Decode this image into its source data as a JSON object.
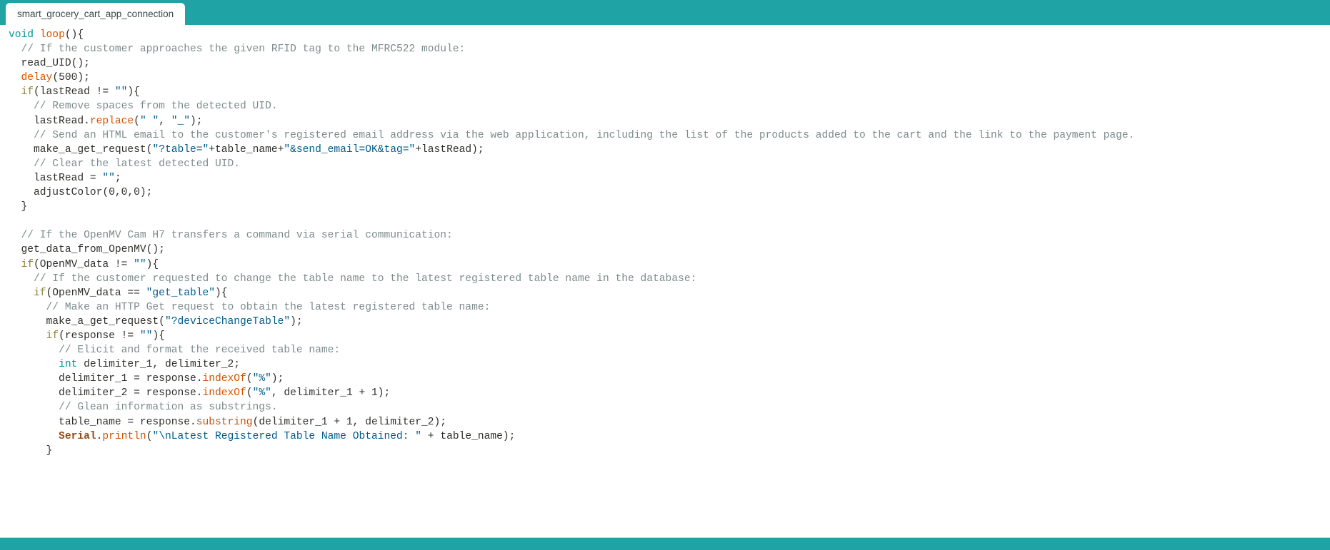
{
  "window": {
    "title": "smart_grocery_cart_app_connection",
    "accent_color": "#1fa3a5",
    "background_color": "#ffffff"
  },
  "tabbar": {
    "tabs": [
      {
        "label": "smart_grocery_cart_app_connection",
        "active": true
      }
    ]
  },
  "editor": {
    "language": "arduino-cpp",
    "font_size": "14.6px",
    "colors": {
      "type_keyword": "#00979c",
      "control_keyword": "#8f8538",
      "function": "#d35400",
      "string": "#005c8a",
      "comment": "#7e8b8c",
      "object": "#924d18",
      "plain": "#31302c"
    },
    "lines": [
      {
        "n": 1,
        "tokens": [
          {
            "t": "type",
            "v": "void"
          },
          {
            "t": "plain",
            "v": " "
          },
          {
            "t": "fn",
            "v": "loop"
          },
          {
            "t": "plain",
            "v": "(){"
          }
        ]
      },
      {
        "n": 2,
        "tokens": [
          {
            "t": "plain",
            "v": "  "
          },
          {
            "t": "com",
            "v": "// If the customer approaches the given RFID tag to the MFRC522 module:"
          }
        ]
      },
      {
        "n": 3,
        "tokens": [
          {
            "t": "plain",
            "v": "  read_UID();"
          }
        ]
      },
      {
        "n": 4,
        "tokens": [
          {
            "t": "plain",
            "v": "  "
          },
          {
            "t": "fn",
            "v": "delay"
          },
          {
            "t": "plain",
            "v": "(500);"
          }
        ]
      },
      {
        "n": 5,
        "tokens": [
          {
            "t": "plain",
            "v": "  "
          },
          {
            "t": "kw",
            "v": "if"
          },
          {
            "t": "plain",
            "v": "(lastRead != "
          },
          {
            "t": "str",
            "v": "\"\""
          },
          {
            "t": "plain",
            "v": "){"
          }
        ]
      },
      {
        "n": 6,
        "tokens": [
          {
            "t": "plain",
            "v": "    "
          },
          {
            "t": "com",
            "v": "// Remove spaces from the detected UID."
          }
        ]
      },
      {
        "n": 7,
        "tokens": [
          {
            "t": "plain",
            "v": "    lastRead."
          },
          {
            "t": "fn",
            "v": "replace"
          },
          {
            "t": "plain",
            "v": "("
          },
          {
            "t": "str",
            "v": "\" \""
          },
          {
            "t": "plain",
            "v": ", "
          },
          {
            "t": "str",
            "v": "\"_\""
          },
          {
            "t": "plain",
            "v": ");"
          }
        ]
      },
      {
        "n": 8,
        "tokens": [
          {
            "t": "plain",
            "v": "    "
          },
          {
            "t": "com",
            "v": "// Send an HTML email to the customer's registered email address via the web application, including the list of the products added to the cart and the link to the payment page."
          }
        ]
      },
      {
        "n": 9,
        "tokens": [
          {
            "t": "plain",
            "v": "    make_a_get_request("
          },
          {
            "t": "str",
            "v": "\"?table=\""
          },
          {
            "t": "plain",
            "v": "+table_name+"
          },
          {
            "t": "str",
            "v": "\"&send_email=OK&tag=\""
          },
          {
            "t": "plain",
            "v": "+lastRead);"
          }
        ]
      },
      {
        "n": 10,
        "tokens": [
          {
            "t": "plain",
            "v": "    "
          },
          {
            "t": "com",
            "v": "// Clear the latest detected UID."
          }
        ]
      },
      {
        "n": 11,
        "tokens": [
          {
            "t": "plain",
            "v": "    lastRead = "
          },
          {
            "t": "str",
            "v": "\"\""
          },
          {
            "t": "plain",
            "v": ";"
          }
        ]
      },
      {
        "n": 12,
        "tokens": [
          {
            "t": "plain",
            "v": "    adjustColor(0,0,0);"
          }
        ]
      },
      {
        "n": 13,
        "tokens": [
          {
            "t": "plain",
            "v": "  }"
          }
        ]
      },
      {
        "n": 14,
        "tokens": [
          {
            "t": "plain",
            "v": ""
          }
        ]
      },
      {
        "n": 15,
        "tokens": [
          {
            "t": "plain",
            "v": "  "
          },
          {
            "t": "com",
            "v": "// If the OpenMV Cam H7 transfers a command via serial communication:"
          }
        ]
      },
      {
        "n": 16,
        "tokens": [
          {
            "t": "plain",
            "v": "  get_data_from_OpenMV();"
          }
        ]
      },
      {
        "n": 17,
        "tokens": [
          {
            "t": "plain",
            "v": "  "
          },
          {
            "t": "kw",
            "v": "if"
          },
          {
            "t": "plain",
            "v": "(OpenMV_data != "
          },
          {
            "t": "str",
            "v": "\"\""
          },
          {
            "t": "plain",
            "v": "){"
          }
        ]
      },
      {
        "n": 18,
        "tokens": [
          {
            "t": "plain",
            "v": "    "
          },
          {
            "t": "com",
            "v": "// If the customer requested to change the table name to the latest registered table name in the database:"
          }
        ]
      },
      {
        "n": 19,
        "tokens": [
          {
            "t": "plain",
            "v": "    "
          },
          {
            "t": "kw",
            "v": "if"
          },
          {
            "t": "plain",
            "v": "(OpenMV_data == "
          },
          {
            "t": "str",
            "v": "\"get_table\""
          },
          {
            "t": "plain",
            "v": "){"
          }
        ]
      },
      {
        "n": 20,
        "tokens": [
          {
            "t": "plain",
            "v": "      "
          },
          {
            "t": "com",
            "v": "// Make an HTTP Get request to obtain the latest registered table name:"
          }
        ]
      },
      {
        "n": 21,
        "tokens": [
          {
            "t": "plain",
            "v": "      make_a_get_request("
          },
          {
            "t": "str",
            "v": "\"?deviceChangeTable\""
          },
          {
            "t": "plain",
            "v": ");"
          }
        ]
      },
      {
        "n": 22,
        "tokens": [
          {
            "t": "plain",
            "v": "      "
          },
          {
            "t": "kw",
            "v": "if"
          },
          {
            "t": "plain",
            "v": "(response != "
          },
          {
            "t": "str",
            "v": "\"\""
          },
          {
            "t": "plain",
            "v": "){"
          }
        ]
      },
      {
        "n": 23,
        "tokens": [
          {
            "t": "plain",
            "v": "        "
          },
          {
            "t": "com",
            "v": "// Elicit and format the received table name:"
          }
        ]
      },
      {
        "n": 24,
        "tokens": [
          {
            "t": "plain",
            "v": "        "
          },
          {
            "t": "type",
            "v": "int"
          },
          {
            "t": "plain",
            "v": " delimiter_1, delimiter_2;"
          }
        ]
      },
      {
        "n": 25,
        "tokens": [
          {
            "t": "plain",
            "v": "        delimiter_1 = response."
          },
          {
            "t": "fn",
            "v": "indexOf"
          },
          {
            "t": "plain",
            "v": "("
          },
          {
            "t": "str",
            "v": "\"%\""
          },
          {
            "t": "plain",
            "v": ");"
          }
        ]
      },
      {
        "n": 26,
        "tokens": [
          {
            "t": "plain",
            "v": "        delimiter_2 = response."
          },
          {
            "t": "fn",
            "v": "indexOf"
          },
          {
            "t": "plain",
            "v": "("
          },
          {
            "t": "str",
            "v": "\"%\""
          },
          {
            "t": "plain",
            "v": ", delimiter_1 + 1);"
          }
        ]
      },
      {
        "n": 27,
        "tokens": [
          {
            "t": "plain",
            "v": "        "
          },
          {
            "t": "com",
            "v": "// Glean information as substrings."
          }
        ]
      },
      {
        "n": 28,
        "tokens": [
          {
            "t": "plain",
            "v": "        table_name = response."
          },
          {
            "t": "fn",
            "v": "substring"
          },
          {
            "t": "plain",
            "v": "(delimiter_1 + 1, delimiter_2);"
          }
        ]
      },
      {
        "n": 29,
        "tokens": [
          {
            "t": "obj",
            "v": "        Serial"
          },
          {
            "t": "plain",
            "v": "."
          },
          {
            "t": "fn",
            "v": "println"
          },
          {
            "t": "plain",
            "v": "("
          },
          {
            "t": "str",
            "v": "\"\\nLatest Registered Table Name Obtained: \""
          },
          {
            "t": "plain",
            "v": " + table_name);"
          }
        ]
      },
      {
        "n": 30,
        "tokens": [
          {
            "t": "plain",
            "v": "      }"
          }
        ]
      }
    ]
  },
  "statusbar": {
    "text": ""
  }
}
